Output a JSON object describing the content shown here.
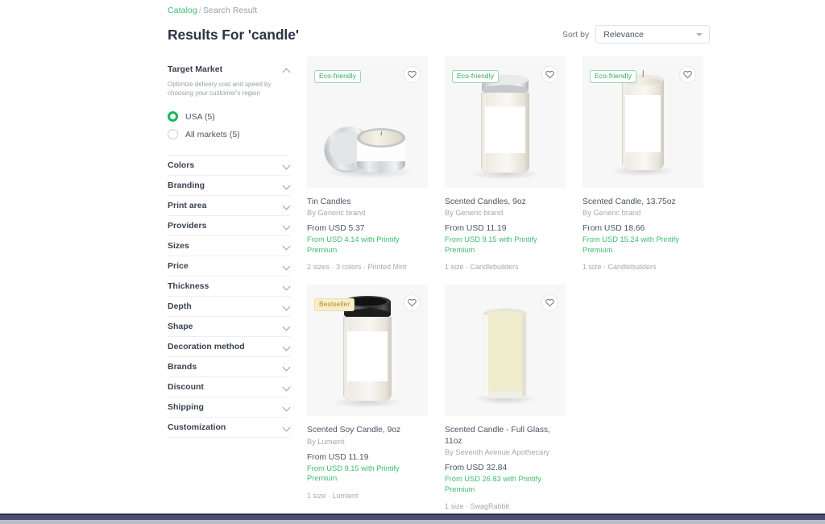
{
  "breadcrumb": {
    "root": "Catalog",
    "separator": "/",
    "current": "Search Result"
  },
  "page_title": "Results For 'candle'",
  "sort": {
    "label": "Sort by",
    "value": "Relevance",
    "icon": "chevron-down-icon"
  },
  "sidebar": {
    "target_market": {
      "title": "Target Market",
      "description": "Optimize delivery cost and speed by choosing your customer's region",
      "options": [
        {
          "label": "USA (5)",
          "selected": true
        },
        {
          "label": "All markets (5)",
          "selected": false
        }
      ]
    },
    "filters": [
      {
        "label": "Colors"
      },
      {
        "label": "Branding"
      },
      {
        "label": "Print area"
      },
      {
        "label": "Providers"
      },
      {
        "label": "Sizes"
      },
      {
        "label": "Price"
      },
      {
        "label": "Thickness"
      },
      {
        "label": "Depth"
      },
      {
        "label": "Shape"
      },
      {
        "label": "Decoration method"
      },
      {
        "label": "Brands"
      },
      {
        "label": "Discount"
      },
      {
        "label": "Shipping"
      },
      {
        "label": "Customization"
      }
    ]
  },
  "colors": {
    "accent_green": "#3dbd6e",
    "badge_eco_text": "#2fa85c",
    "badge_best_text": "#b88a18",
    "radio_selected": "#16b85c",
    "title_text": "#2b3445"
  },
  "products": [
    {
      "badge": "Eco-friendly",
      "badge_type": "eco",
      "favorite_icon": "heart-icon",
      "image_kind": "tin-candle",
      "title": "Tin Candles",
      "brand": "By Generic brand",
      "price": "From USD 5.37",
      "premium_price": "From USD 4.14 with Printify Premium",
      "meta": "2 sizes · 3 colors · Printed Mint"
    },
    {
      "badge": "Eco-friendly",
      "badge_type": "eco",
      "favorite_icon": "heart-icon",
      "image_kind": "jar-candle",
      "title": "Scented Candles, 9oz",
      "brand": "By Generic brand",
      "price": "From USD 11.19",
      "premium_price": "From USD 9.15 with Printify Premium",
      "meta": "1 size · Candlebuilders"
    },
    {
      "badge": "Eco-friendly",
      "badge_type": "eco",
      "favorite_icon": "heart-icon",
      "image_kind": "tall-candle",
      "title": "Scented Candle, 13.75oz",
      "brand": "By Generic brand",
      "price": "From USD 18.66",
      "premium_price": "From USD 15.24 with Printify Premium",
      "meta": "1 size · Candlebuilders"
    },
    {
      "badge": "Bestseller",
      "badge_type": "best",
      "favorite_icon": "heart-icon",
      "image_kind": "black-lid-candle",
      "title": "Scented Soy Candle, 9oz",
      "brand": "By Lumient",
      "price": "From USD 11.19",
      "premium_price": "From USD 9.15 with Printify Premium",
      "meta": "1 size · Lumient"
    },
    {
      "badge": "",
      "badge_type": "none",
      "favorite_icon": "heart-icon",
      "image_kind": "glass-candle",
      "title": "Scented Candle - Full Glass, 11oz",
      "brand": "By Seventh Avenue Apothecary",
      "price": "From USD 32.84",
      "premium_price": "From USD 26.83 with Printify Premium",
      "meta": "1 size · SwagRabbit"
    }
  ]
}
